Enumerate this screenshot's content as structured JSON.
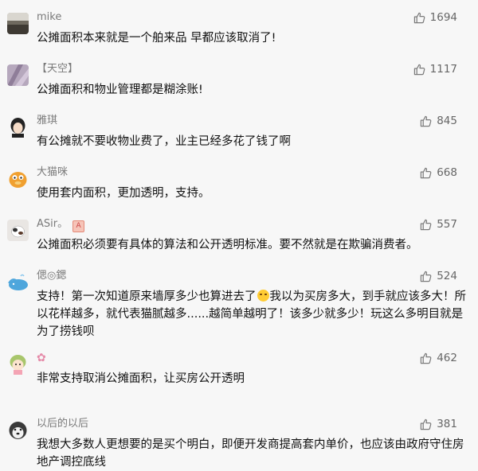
{
  "comments": [
    {
      "user": "mike",
      "text": "公摊面积本来就是一个舶来品 早都应该取消了!",
      "likes": "1694",
      "avatar": "landscape-photo"
    },
    {
      "user": "【天空】",
      "text": "公摊面积和物业管理都是糊涂账!",
      "likes": "1117",
      "avatar": "purple-abstract"
    },
    {
      "user": "雅琪",
      "text": "有公摊就不要收物业费了，业主已经多花了钱了啊",
      "likes": "845",
      "avatar": "cartoon-girl"
    },
    {
      "user": "大猫咪",
      "text": "使用套内面积，更加透明，支持。",
      "likes": "668",
      "avatar": "garfield-cat"
    },
    {
      "user": "ASir。",
      "text": "公摊面积必须要有具体的算法和公开透明标准。要不然就是在欺骗消费者。",
      "likes": "557",
      "avatar": "cat-photo",
      "badge": "A"
    },
    {
      "user": "偲◎鍶",
      "text_parts": [
        "支持！第一次知道原来墙厚多少也算进去了",
        "我以为买房多大，到手就应该多大！所以花样越多，就代表猫腻越多......越简单越明了！该多少就多少！玩这么多明目就是为了捞钱呗"
      ],
      "likes": "524",
      "avatar": "whale"
    },
    {
      "user": "✿",
      "text": "非常支持取消公摊面积，让买房公开透明",
      "likes": "462",
      "avatar": "cartoon-child"
    },
    {
      "user": "以后的以后",
      "text": "我想大多数人更想要的是买个明白，即便开发商提高套内单价，也应该由政府守住房地产调控底线",
      "likes": "381",
      "avatar": "husky-dog"
    }
  ],
  "icons": {
    "like": "thumbs-up-icon",
    "emoji": "teary-face-emoji"
  },
  "colors": {
    "name": "#7a7a7a",
    "like": "#7a7a7a",
    "text": "#111111"
  }
}
